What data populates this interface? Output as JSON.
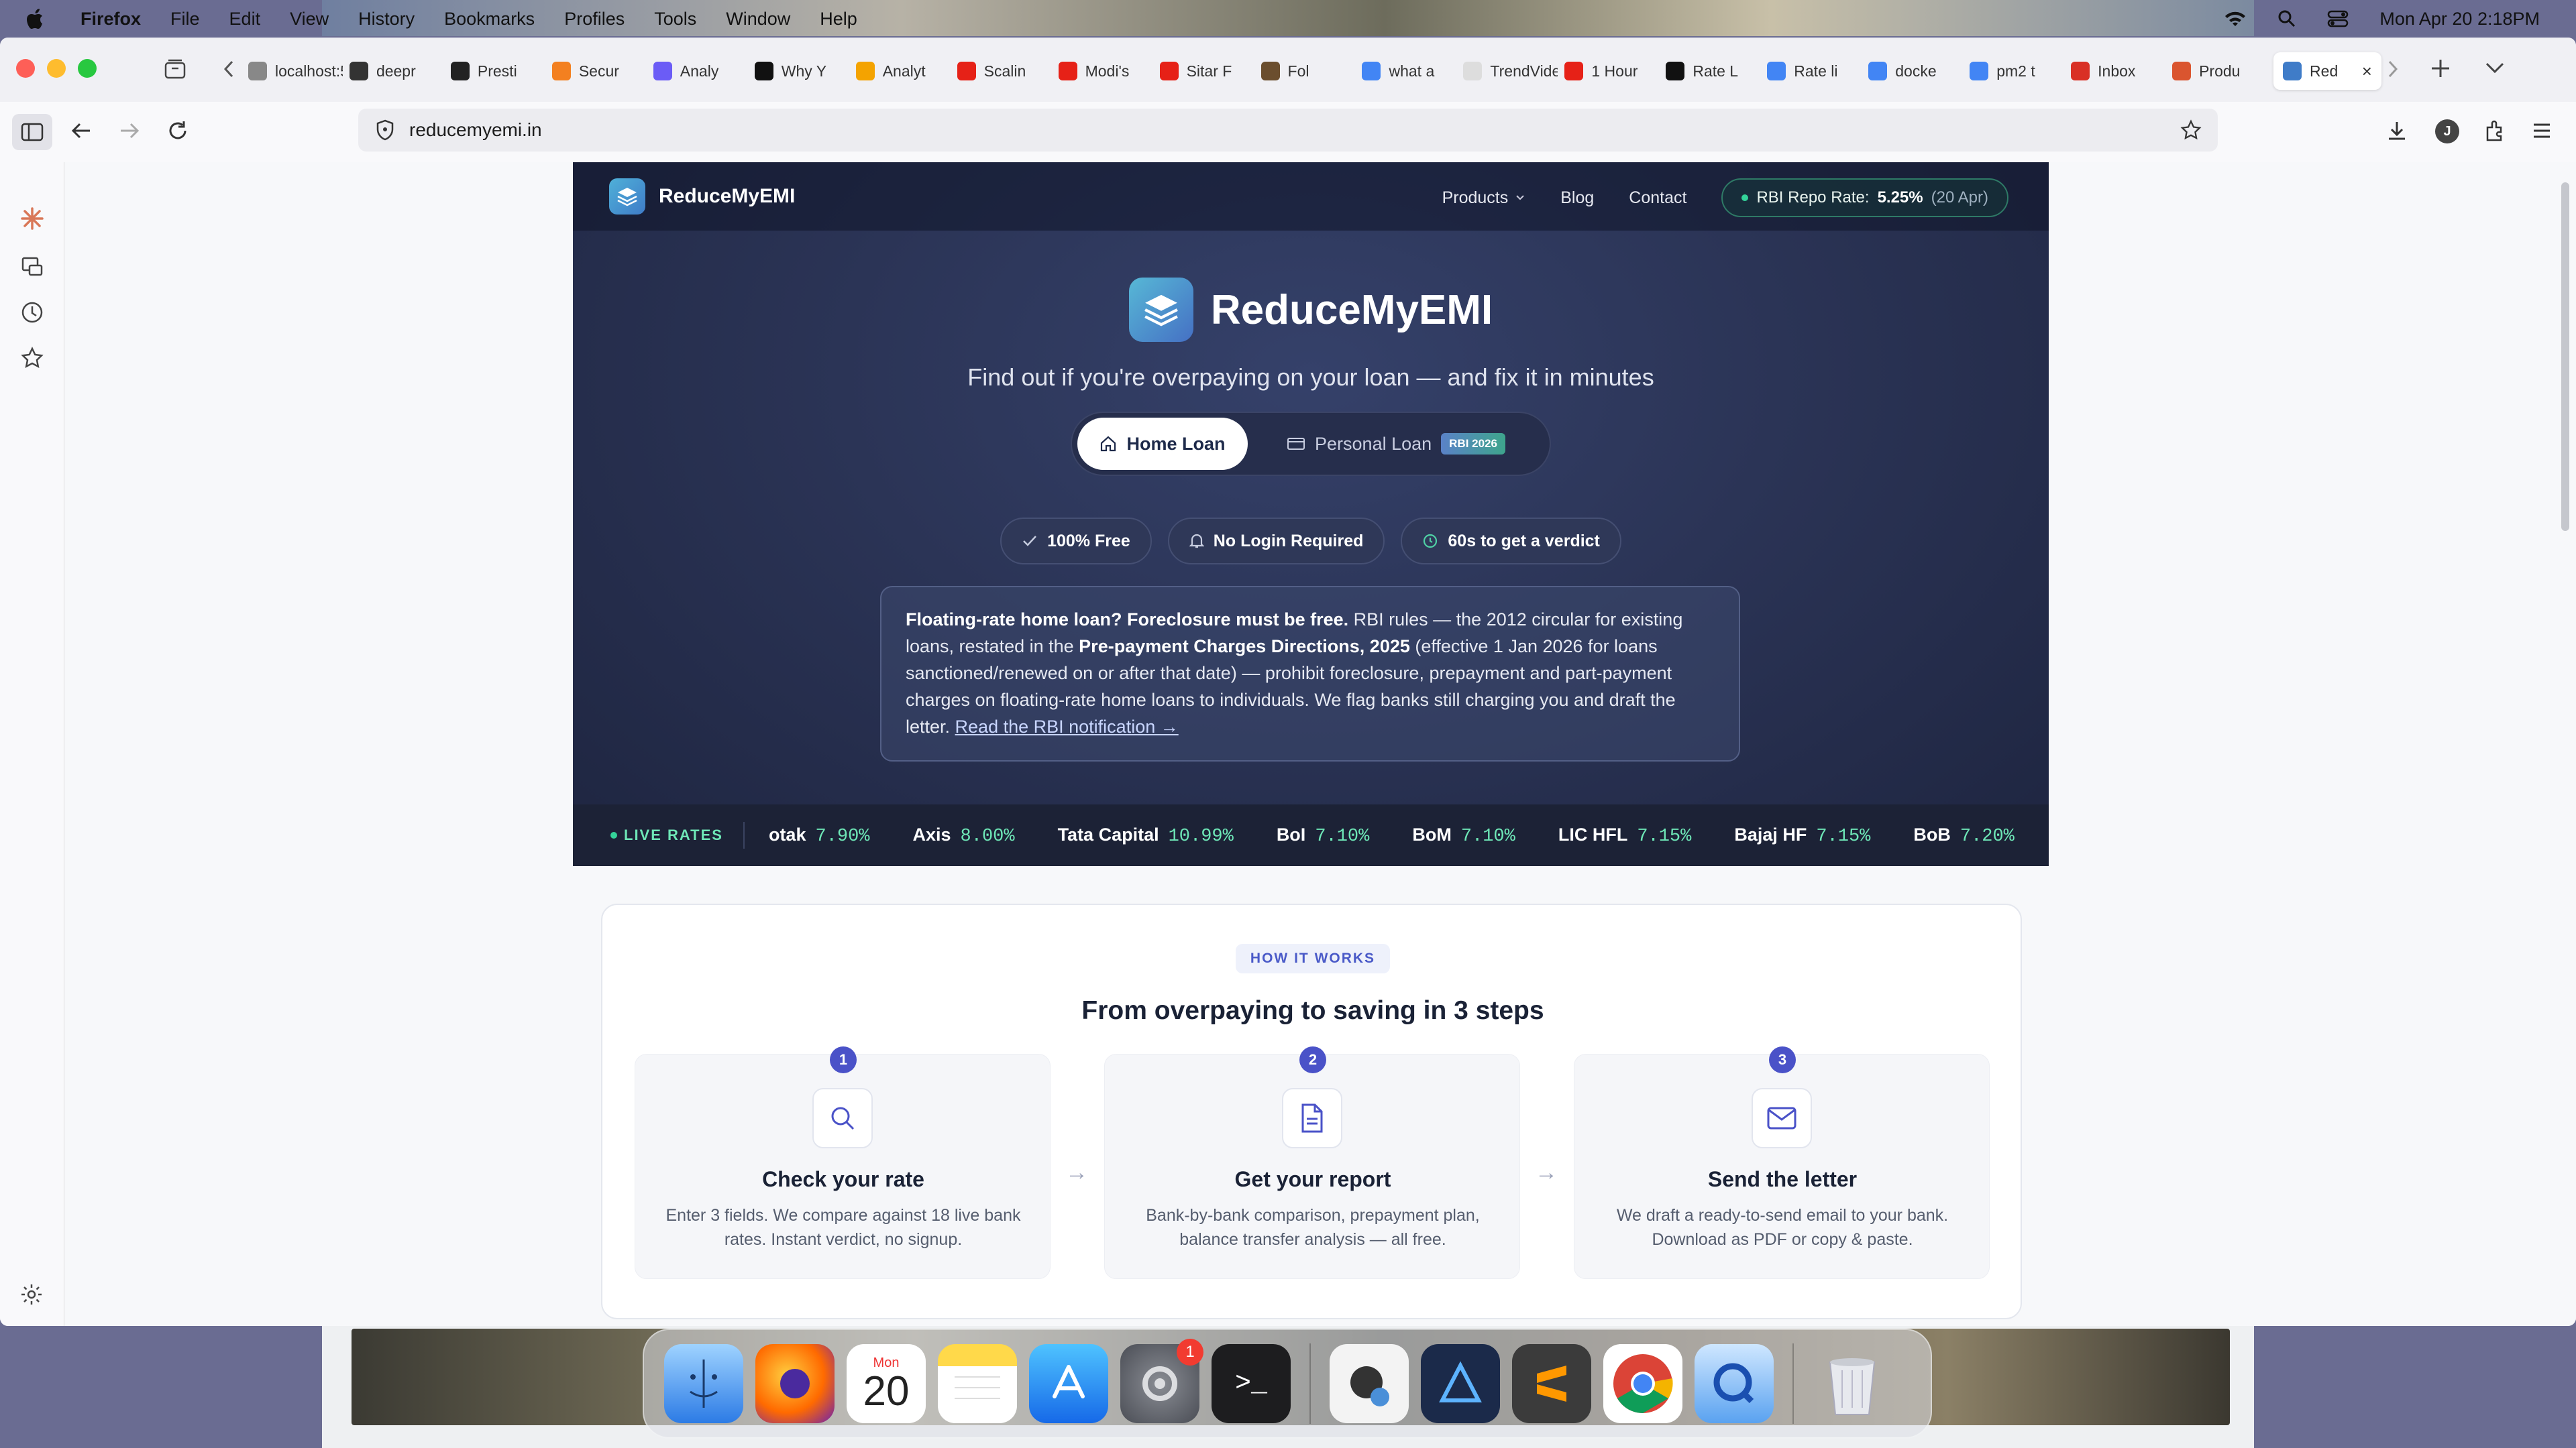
{
  "menubar": {
    "app": "Firefox",
    "items": [
      "File",
      "Edit",
      "View",
      "History",
      "Bookmarks",
      "Profiles",
      "Tools",
      "Window",
      "Help"
    ],
    "datetime": "Mon Apr 20  2:18PM"
  },
  "tabs": [
    {
      "label": "localhost:5",
      "icon": "globe-icon",
      "color": "#888888"
    },
    {
      "label": "deepr",
      "icon": "github-icon",
      "color": "#333333"
    },
    {
      "label": "Presti",
      "icon": "prestige-icon",
      "color": "#222222"
    },
    {
      "label": "Secur",
      "icon": "cloudflare-icon",
      "color": "#f38020"
    },
    {
      "label": "Analy",
      "icon": "spark-icon",
      "color": "#6b5cf6"
    },
    {
      "label": "Why Y",
      "icon": "notion-icon",
      "color": "#111111"
    },
    {
      "label": "Analyt",
      "icon": "analytics-icon",
      "color": "#f4a300"
    },
    {
      "label": "Scalin",
      "icon": "youtube-icon",
      "color": "#e62117"
    },
    {
      "label": "Modi's",
      "icon": "youtube-icon",
      "color": "#e62117"
    },
    {
      "label": "Sitar F",
      "icon": "youtube-icon",
      "color": "#e62117"
    },
    {
      "label": "Fol",
      "icon": "image-icon",
      "color": "#6b4e2e"
    },
    {
      "label": "what a",
      "icon": "google-icon",
      "color": "#4285f4"
    },
    {
      "label": "TrendVide",
      "icon": "blank-icon",
      "color": "#dddddd"
    },
    {
      "label": "1 Hour",
      "icon": "youtube-icon",
      "color": "#e62117"
    },
    {
      "label": "Rate L",
      "icon": "ratel-icon",
      "color": "#111111"
    },
    {
      "label": "Rate li",
      "icon": "google-icon",
      "color": "#4285f4"
    },
    {
      "label": "docke",
      "icon": "google-icon",
      "color": "#4285f4"
    },
    {
      "label": "pm2 t",
      "icon": "google-icon",
      "color": "#4285f4"
    },
    {
      "label": "Inbox",
      "icon": "gmail-icon",
      "color": "#d93025"
    },
    {
      "label": "Produ",
      "icon": "producthunt-icon",
      "color": "#da552f"
    },
    {
      "label": "Red",
      "icon": "reducemyemi-icon",
      "color": "#3f7cc8",
      "active": true
    }
  ],
  "urlbar": {
    "url": "reducemyemi.in"
  },
  "site": {
    "logo_text": "ReduceMyEMI",
    "nav": {
      "products": "Products",
      "blog": "Blog",
      "contact": "Contact"
    },
    "repo": {
      "label": "RBI Repo Rate:",
      "value": "5.25%",
      "date": "(20 Apr)"
    },
    "brand": "ReduceMyEMI",
    "tagline": "Find out if you're overpaying on your loan — and fix it in minutes",
    "toggle": {
      "home": "Home Loan",
      "personal": "Personal Loan",
      "badge": "RBI 2026"
    },
    "pills": [
      "100% Free",
      "No Login Required",
      "60s to get a verdict"
    ],
    "notice": {
      "bold1": "Floating-rate home loan? Foreclosure must be free.",
      "text1": " RBI rules — the 2012 circular for existing loans, restated in the ",
      "bold2": "Pre-payment Charges Directions, 2025",
      "text2": " (effective 1 Jan 2026 for loans sanctioned/renewed on or after that date) — prohibit foreclosure, prepayment and part-payment charges on floating-rate home loans to individuals. We flag banks still charging you and draft the letter. ",
      "link": "Read the RBI notification →"
    },
    "ticker": {
      "label": "LIVE RATES",
      "rates": [
        {
          "bank": "otak",
          "rate": "7.90%"
        },
        {
          "bank": "Axis",
          "rate": "8.00%"
        },
        {
          "bank": "Tata Capital",
          "rate": "10.99%"
        },
        {
          "bank": "BoI",
          "rate": "7.10%"
        },
        {
          "bank": "BoM",
          "rate": "7.10%"
        },
        {
          "bank": "LIC HFL",
          "rate": "7.15%"
        },
        {
          "bank": "Bajaj HF",
          "rate": "7.15%"
        },
        {
          "bank": "BoB",
          "rate": "7.20%"
        }
      ]
    },
    "how": {
      "tag": "HOW IT WORKS",
      "title": "From overpaying to saving in 3 steps",
      "steps": [
        {
          "num": "1",
          "icon": "search-icon",
          "title": "Check your rate",
          "desc": "Enter 3 fields. We compare against 18 live bank rates. Instant verdict, no signup."
        },
        {
          "num": "2",
          "icon": "document-icon",
          "title": "Get your report",
          "desc": "Bank-by-bank comparison, prepayment plan, balance transfer analysis — all free."
        },
        {
          "num": "3",
          "icon": "mail-icon",
          "title": "Send the letter",
          "desc": "We draft a ready-to-send email to your bank. Download as PDF or copy & paste."
        }
      ]
    }
  },
  "dock": {
    "calendar_month": "Mon",
    "calendar_day": "20",
    "settings_badge": "1",
    "items": [
      "finder-icon",
      "firefox-icon",
      "calendar-icon",
      "notes-icon",
      "app-store-icon",
      "system-settings-icon",
      "terminal-icon",
      "cheatengine-icon",
      "affinity-icon",
      "sublime-icon",
      "chrome-icon",
      "quicktime-icon",
      "trash-icon"
    ]
  }
}
